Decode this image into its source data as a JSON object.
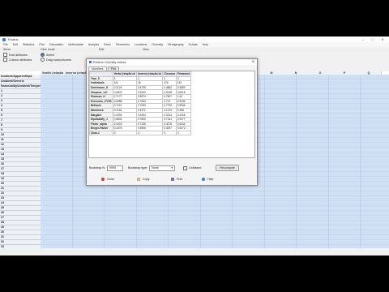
{
  "window": {
    "title": "Rudeus",
    "controls": [
      "–",
      "□",
      "✕"
    ]
  },
  "menu": [
    "File",
    "Edit",
    "Statistics",
    "Plot",
    "Calculation",
    "Multivariate",
    "Analysis",
    "Extra",
    "Timeseries",
    "Locations",
    "Diversity",
    "Stratigraphy",
    "Scripts",
    "Help"
  ],
  "options": {
    "show_label": "Show",
    "click_label": "Click mode",
    "edit_label": "Edit",
    "view_label": "View",
    "row_attributes": "Row attributes",
    "column_attributes": "Column attributes",
    "select": "Select",
    "drag": "Drag rows/columns"
  },
  "sheet": {
    "col_heads": [
      "Ventile (relação chuvas)",
      "Inverno (relação ch)",
      "Chuvosa (relação ch)",
      "",
      "",
      "",
      "",
      "",
      "L",
      "M",
      "N",
      "O",
      "P",
      "Q"
    ],
    "row_heads": [
      "Ambient/Apparent/tips",
      "Ambient/Generic",
      "Seasonality/Ambient/Temperature",
      "1",
      "2",
      "3",
      "4",
      "5",
      "6",
      "7",
      "8",
      "9",
      "10",
      "11",
      "12",
      "13",
      "14",
      "15",
      "16",
      "17",
      "18",
      "19",
      "20",
      "21",
      "22",
      "23",
      "24",
      "25",
      "26",
      "27",
      "28",
      "29",
      "30",
      "31",
      "32",
      "33"
    ]
  },
  "dialog": {
    "title": "Rudeus: Diversity indices",
    "close": "✕",
    "tabs": [
      "Numbers",
      "Plot"
    ],
    "columns": [
      "",
      "Verão (relação ch",
      "Inverno (relação ch",
      "Chuvosa",
      "Primavera"
    ],
    "rows": [
      [
        "Taxa_S",
        "3",
        "3",
        "3",
        "3"
      ],
      [
        "Individuals",
        "161",
        "45",
        "476",
        "144"
      ],
      [
        "Dominance_D",
        "0.3124",
        "0.4708",
        "0.4862",
        "0.3689"
      ],
      [
        "Simpson_1-D",
        "0.6876",
        "0.5292",
        "0.5138",
        "0.6318"
      ],
      [
        "Shannon_H",
        "0.7177",
        "0.8574",
        "0.7807",
        "1.04"
      ],
      [
        "Evenness_e^H/S",
        "0.6588",
        "0.7833",
        "0.712",
        "0.9436"
      ],
      [
        "Brillouin",
        "0.7113",
        "0.7053",
        "0.7752",
        "0.9946"
      ],
      [
        "Menhinick",
        "0.2152",
        "0.4472",
        "0.1375",
        "0.288"
      ],
      [
        "Margalef",
        "0.3394",
        "0.5254",
        "0.3234",
        "0.4155"
      ],
      [
        "Equitability_J",
        "0.6604",
        "0.7805",
        "0.7161",
        "0.9477"
      ],
      [
        "Fisher_alpha",
        "0.4478",
        "0.7235",
        "0.4275",
        "0.5244"
      ],
      [
        "Berger-Parker",
        "0.4478",
        "0.5556",
        "0.4097",
        "0.4472"
      ],
      [
        "Chao-1",
        "3",
        "3",
        "3",
        "3"
      ]
    ],
    "bootstrap_label": "Bootstrap N:",
    "bootstrap_value": "9999",
    "bootstrap_type_label": "Bootstrap type:",
    "bootstrap_type": "None",
    "unbiased_label": "Unbiased",
    "recompute": "Recompute",
    "btn_close": "Close",
    "btn_copy": "Copy",
    "btn_print": "Print",
    "btn_help": "Help",
    "colors": {
      "close": "#d03a3a",
      "copy": "#c9b98a",
      "print": "#8a6fa8",
      "help": "#3a7bd5"
    }
  }
}
